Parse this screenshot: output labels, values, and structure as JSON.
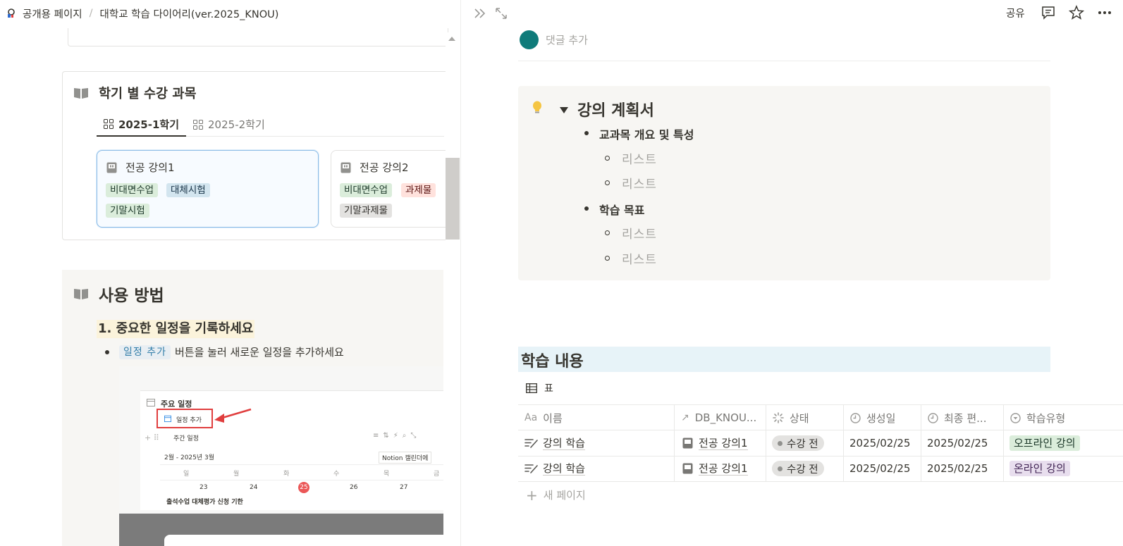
{
  "breadcrumb": {
    "workspace": "공개용 페이지",
    "separator": "/",
    "page": "대학교 학습 다이어리(ver.2025_KNOU)"
  },
  "courses": {
    "title": "학기 별 수강 과목",
    "tabs": [
      {
        "label": "2025-1학기",
        "active": true
      },
      {
        "label": "2025-2학기",
        "active": false
      }
    ],
    "cards": [
      {
        "title": "전공 강의1",
        "tags": [
          {
            "label": "비대면수업",
            "color": "green"
          },
          {
            "label": "대체시험",
            "color": "blue"
          },
          {
            "label": "기말시험",
            "color": "green"
          }
        ]
      },
      {
        "title": "전공 강의2",
        "tags": [
          {
            "label": "비대면수업",
            "color": "green"
          },
          {
            "label": "과제물",
            "color": "red"
          },
          {
            "label": "기말과제물",
            "color": "gray"
          }
        ]
      }
    ]
  },
  "usage": {
    "title": "사용 방법",
    "step1": "1. 중요한 일정을 기록하세요",
    "bullet_code": "일정 추가",
    "bullet_text": "버튼을 눌러 새로운 일정을 추가하세요",
    "screenshot": {
      "title": "주요 일정",
      "add_button": "일정 추가",
      "view": "주간 일정",
      "range": "2월 - 2025년 3월",
      "notion_cal": "Notion 캘린더에",
      "weekdays": [
        "일",
        "월",
        "화",
        "수",
        "목",
        "금"
      ],
      "days": [
        "23",
        "24",
        "25",
        "26",
        "27"
      ],
      "event": "출석수업 대체평가 신청 기한"
    }
  },
  "topbar": {
    "share": "공유"
  },
  "comment": {
    "placeholder": "댓글 추가"
  },
  "callout": {
    "title": "강의 계획서",
    "sections": [
      {
        "label": "교과목 개요 및 특성",
        "items": [
          "리스트",
          "리스트"
        ]
      },
      {
        "label": "학습 목표",
        "items": [
          "리스트",
          "리스트"
        ]
      }
    ]
  },
  "learning": {
    "heading": "학습 내용",
    "view_label": "표",
    "columns": [
      "이름",
      "DB_KNOU...",
      "상태",
      "생성일",
      "최종 편...",
      "학습유형"
    ],
    "col_icons": [
      "Aa",
      "↗"
    ],
    "rows": [
      {
        "name": "강의 학습",
        "relation": "전공 강의1",
        "status": "수강 전",
        "created": "2025/02/25",
        "edited": "2025/02/25",
        "type": "오프라인 강의",
        "type_color": "green"
      },
      {
        "name": "강의 학습",
        "relation": "전공 강의1",
        "status": "수강 전",
        "created": "2025/02/25",
        "edited": "2025/02/25",
        "type": "온라인 강의",
        "type_color": "purple"
      }
    ],
    "new_page": "새 페이지"
  },
  "colors": {
    "accent": "#2383e2",
    "callout_bg": "#f7f6f3",
    "heading_bg": "#e7f3f8",
    "avatar": "#0f7b7a",
    "red_box": "#e03e3e"
  }
}
